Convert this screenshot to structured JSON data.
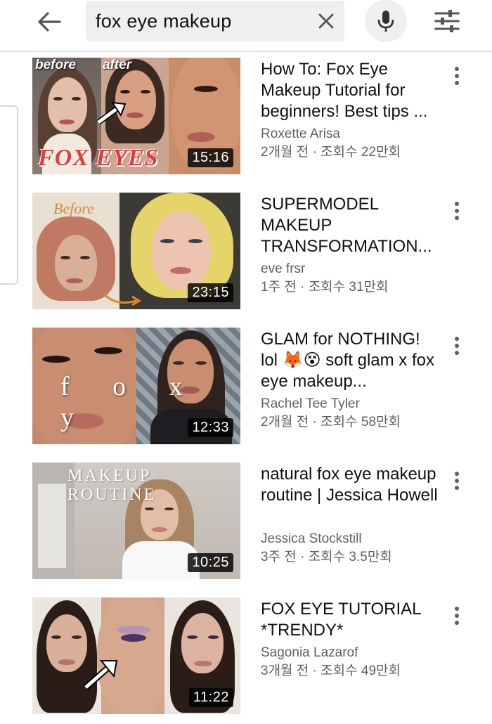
{
  "search": {
    "query": "fox eye makeup"
  },
  "icons": {
    "back": "arrow-left-icon",
    "clear": "close-icon",
    "mic": "microphone-icon",
    "filter": "filter-sliders-icon",
    "more": "more-vertical-icon"
  },
  "colors": {
    "meta_text": "#606060",
    "title_text": "#111111",
    "duration_bg": "#000000",
    "search_bg": "#efefef"
  },
  "results": [
    {
      "title": "How To: Fox Eye Makeup Tutorial for beginners! Best tips ...",
      "channel": "Roxette Arisa",
      "stats": "2개월 전 · 조회수 22만회",
      "duration": "15:16",
      "thumb_text": {
        "before": "before",
        "after": "after",
        "main": "FOX EYES"
      }
    },
    {
      "title": "SUPERMODEL MAKEUP TRANSFORMATION...",
      "channel": "eve frsr",
      "stats": "1주 전 · 조회수 31만회",
      "duration": "23:15",
      "thumb_text": {
        "before": "Before"
      }
    },
    {
      "title": "GLAM for NOTHING! lol 🦊😵 soft glam x fox eye makeup...",
      "channel": "Rachel Tee Tyler",
      "stats": "2개월 전 · 조회수 58만회",
      "duration": "12:33",
      "thumb_text": {
        "word": "f o x y"
      }
    },
    {
      "title": "natural fox eye makeup routine | Jessica Howell",
      "channel": "Jessica Stockstill",
      "stats": "3주 전 · 조회수 3.5만회",
      "duration": "10:25",
      "thumb_text": {
        "banner": "MAKEUP ROUTINE"
      }
    },
    {
      "title": "FOX EYE TUTORIAL *TRENDY*",
      "channel": "Sagonia Lazarof",
      "stats": "3개월 전 · 조회수 49만회",
      "duration": "11:22"
    }
  ]
}
